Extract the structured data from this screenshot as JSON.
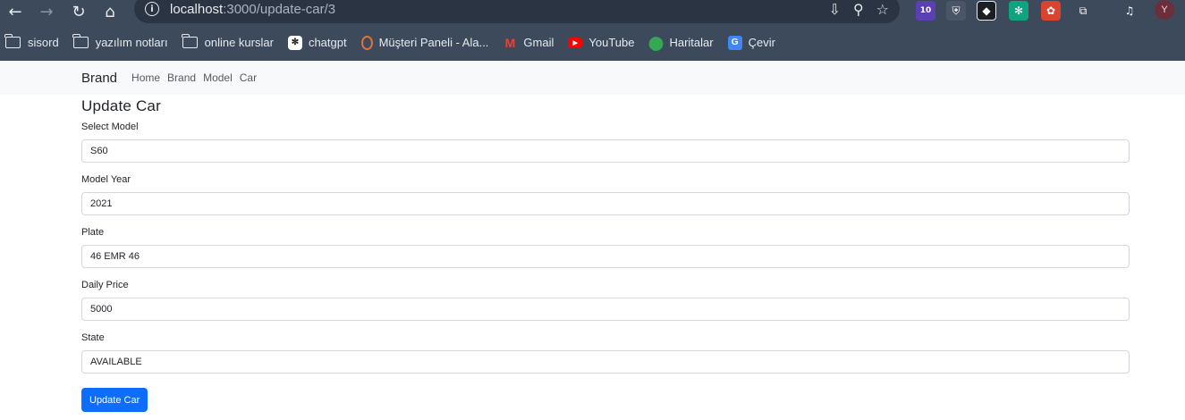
{
  "browser": {
    "url_host": "localhost",
    "url_path": ":3000/update-car/3",
    "profile_initial": "Y",
    "extension_badge": "10"
  },
  "bookmarks": [
    {
      "label": "sisord",
      "icon": "folder-icon"
    },
    {
      "label": "yazılım notları",
      "icon": "folder-icon"
    },
    {
      "label": "online kurslar",
      "icon": "folder-icon"
    },
    {
      "label": "chatgpt",
      "icon": "chatgpt-icon"
    },
    {
      "label": "Müşteri Paneli - Ala...",
      "icon": "panel-icon"
    },
    {
      "label": "Gmail",
      "icon": "gmail-icon"
    },
    {
      "label": "YouTube",
      "icon": "youtube-icon"
    },
    {
      "label": "Haritalar",
      "icon": "maps-icon"
    },
    {
      "label": "Çevir",
      "icon": "translate-icon"
    }
  ],
  "navbar": {
    "brand": "Brand",
    "links": [
      "Home",
      "Brand",
      "Model",
      "Car"
    ]
  },
  "form": {
    "title": "Update Car",
    "fields": [
      {
        "label": "Select Model",
        "value": "S60"
      },
      {
        "label": "Model Year",
        "value": "2021"
      },
      {
        "label": "Plate",
        "value": "46 EMR 46"
      },
      {
        "label": "Daily Price",
        "value": "5000"
      },
      {
        "label": "State",
        "value": "AVAILABLE"
      }
    ],
    "submit_label": "Update Car"
  },
  "colors": {
    "chrome": "#3c4a5c",
    "navbar_bg": "#f8f9fa",
    "primary": "#0d6efd"
  }
}
